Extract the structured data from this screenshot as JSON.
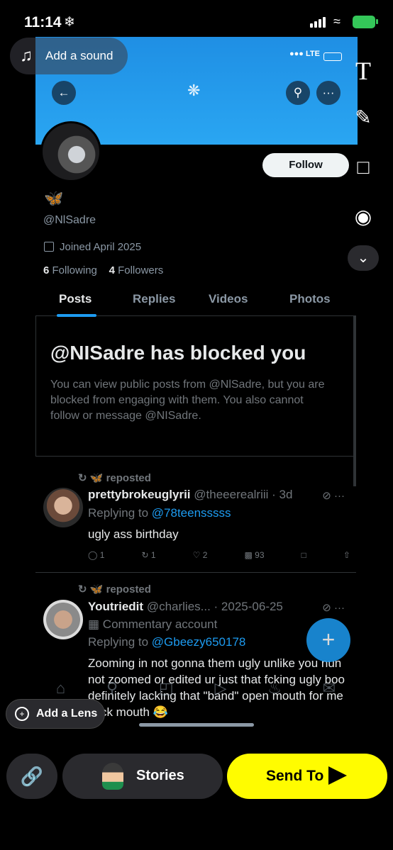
{
  "status_bar": {
    "time": "11:14",
    "snow_icon": "❄"
  },
  "sound": {
    "label": "Add a sound"
  },
  "inner_status": {
    "network": "LTE"
  },
  "profile": {
    "emoji": "🦋",
    "handle": "@NlSadre",
    "joined": "Joined April 2025",
    "following_count": "6",
    "following_label": "Following",
    "followers_count": "4",
    "followers_label": "Followers",
    "follow_label": "Follow"
  },
  "tabs": [
    "Posts",
    "Replies",
    "Videos",
    "Photos"
  ],
  "blocked": {
    "title": "@NISadre has blocked you",
    "body": "You can view public posts from @NlSadre, but you are blocked from engaging with them. You also cannot follow or message @NISadre."
  },
  "posts": [
    {
      "repost_label": "🦋 reposted",
      "name": "prettybrokeuglyrii",
      "meta": "@theeerealriii · 3d",
      "replying_prefix": "Replying to",
      "mention": "@78teensssss",
      "text": "ugly ass birthday",
      "replies": "1",
      "reposts": "1",
      "likes": "2",
      "views": "93"
    },
    {
      "repost_label": "🦋 reposted",
      "name": "Youtriedit",
      "meta": "@charlies... · 2025-06-25",
      "badge": "Commentary account",
      "replying_prefix": "Replying to",
      "mention": "@Gbeezy650178",
      "text": "Zooming in not gonna them ugly unlike you nun not zoomed or edited ur just that fcking ugly boo definitely lacking that \"band\" open mouth for me yuck mouth 😂"
    }
  ],
  "snap": {
    "lens_label": "Add a Lens",
    "stories_label": "Stories",
    "send_label": "Send To"
  },
  "colors": {
    "banner": "#1f8fe4",
    "accent": "#1d9bf0",
    "send_button": "#fffc00"
  }
}
